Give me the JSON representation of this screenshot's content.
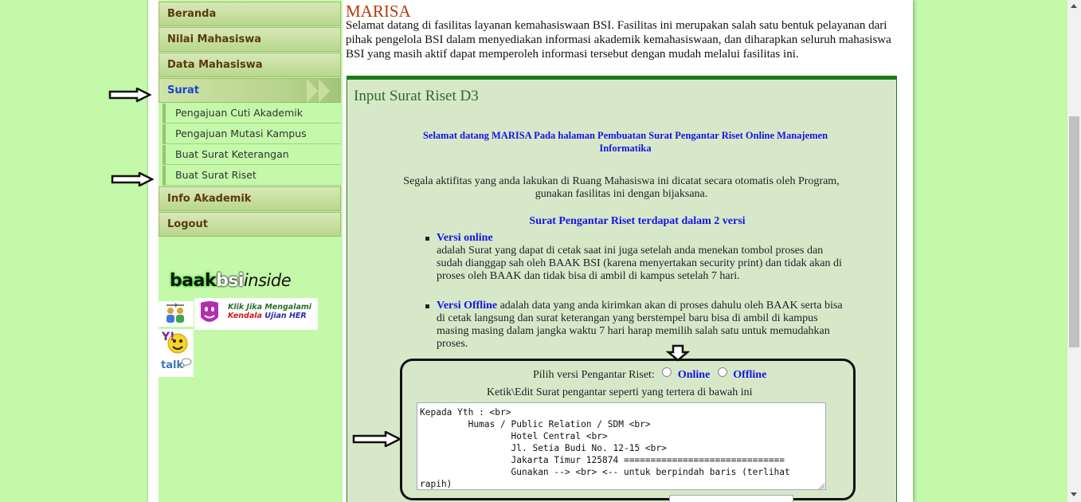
{
  "sidebar": {
    "menu": [
      {
        "label": "Beranda"
      },
      {
        "label": "Nilai Mahasiswa"
      },
      {
        "label": "Data Mahasiswa"
      },
      {
        "label": "Surat"
      },
      {
        "label": "Info Akademik"
      },
      {
        "label": "Logout"
      }
    ],
    "submenu": [
      {
        "label": "Pengajuan Cuti Akademik"
      },
      {
        "label": "Pengajuan Mutasi Kampus"
      },
      {
        "label": "Buat Surat Keterangan"
      },
      {
        "label": "Buat Surat Riset"
      }
    ],
    "logo": {
      "part1": "baak",
      "part2": "bsi",
      "part3": "inside"
    },
    "her_banner": {
      "line1": "Klik Jika Mengalami",
      "line2": "Kendala",
      "line3": "Ujian HER"
    },
    "chat_badge": {
      "label": "talk"
    }
  },
  "main": {
    "title": "MARISA",
    "intro": "Selamat datang di fasilitas layanan kemahasiswaan BSI. Fasilitas ini merupakan salah satu bentuk pelayanan dari pihak pengelola BSI dalam menyediakan informasi akademik kemahasiswaan, dan diharapkan seluruh mahasiswa BSI yang masih aktif dapat memperoleh informasi tersebut dengan mudah melalui fasilitas ini."
  },
  "panel": {
    "title": "Input Surat Riset D3",
    "welcome": "Selamat datang MARISA Pada halaman Pembuatan Surat Pengantar Riset Online Manajemen Informatika",
    "notice": "Segala aktifitas yang anda lakukan di Ruang Mahasiswa ini dicatat secara otomatis oleh Program, gunakan fasilitas ini dengan bijaksana.",
    "versions_heading": "Surat Pengantar Riset terdapat dalam 2 versi",
    "online_title": "Versi online",
    "online_desc": "adalah Surat yang dapat di cetak saat ini juga setelah anda menekan tombol proses dan sudah dianggap sah oleh BAAK BSI (karena menyertakan security print) dan tidak akan di proses oleh BAAK dan tidak bisa di ambil di kampus setelah 7 hari.",
    "offline_title": "Versi Offline",
    "offline_desc": " adalah data yang anda kirimkan akan di proses dahulu oleh BAAK serta bisa di cetak langsung dan surat keterangan yang berstempel baru bisa di ambil di kampus masing masing dalam jangka waktu 7 hari harap memilih salah satu untuk memudahkan proses."
  },
  "form": {
    "version_prompt": "Pilih versi Pengantar Riset:",
    "option_online": "Online",
    "option_offline": "Offline",
    "edit_instruction": "Ketik\\Edit Surat pengantar seperti yang tertera di bawah ini",
    "letter_text": "Kepada Yth : <br>\n         Humas / Public Relation / SDM <br>\n                 Hotel Central <br>\n                 Jl. Setia Budi No. 12-15 <br>\n                 Jakarta Timur 125874 ==============================\n                 Gunakan --> <br> <-- untuk berpindah baris (terlihat rapih)"
  },
  "colors": {
    "background": "#c3f9a9",
    "menu_text": "#5b3a0c",
    "active_menu_text": "#1a3fd9",
    "title": "#b33a0c",
    "panel_bg": "#d7e8c9",
    "panel_border": "#1d7a1a",
    "link_blue": "#1414e6"
  }
}
